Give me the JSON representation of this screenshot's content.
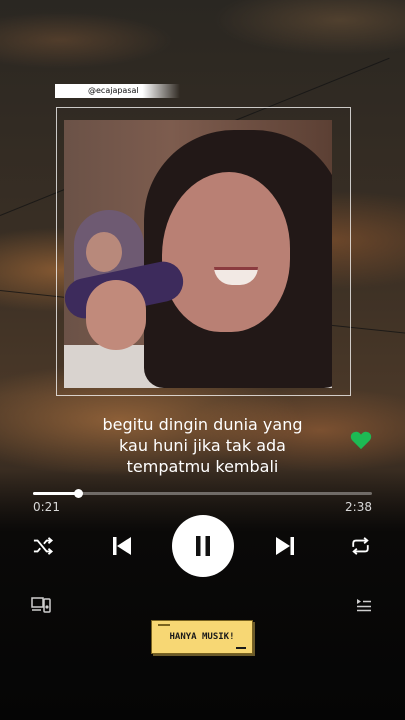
{
  "handle": "@ecajapasal",
  "lyrics": {
    "line1": "begitu dingin dunia yang",
    "line2": "kau huni jika tak ada",
    "line3": "tempatmu kembali"
  },
  "player": {
    "elapsed": "0:21",
    "duration": "2:38",
    "progress_fraction": 0.133,
    "liked": true
  },
  "icons": {
    "shuffle": "shuffle-icon",
    "previous": "skip-previous-icon",
    "pause": "pause-icon",
    "next": "skip-next-icon",
    "repeat": "repeat-icon",
    "devices": "connect-devices-icon",
    "queue": "queue-icon",
    "heart": "heart-icon"
  },
  "badge": {
    "label": "HANYA MUSIK!"
  },
  "colors": {
    "accent_green": "#1DB954",
    "badge_yellow": "#F7D774"
  }
}
